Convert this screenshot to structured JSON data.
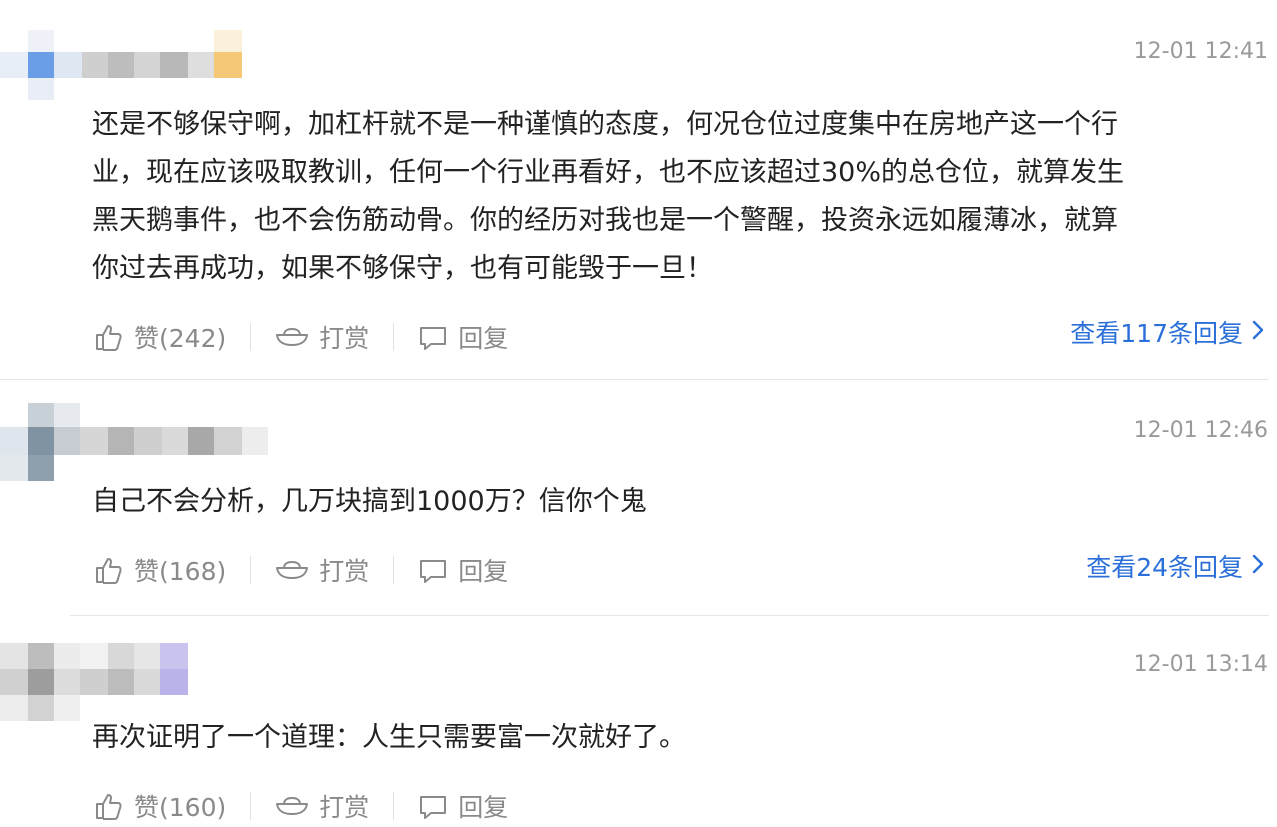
{
  "comments": [
    {
      "time": "12-01 12:41",
      "text": "还是不够保守啊，加杠杆就不是一种谨慎的态度，何况仓位过度集中在房地产这一个行\n业，现在应该吸取教训，任何一个行业再看好，也不应该超过30%的总仓位，就算发生\n黑天鹅事件，也不会伤筋动骨。你的经历对我也是一个警醒，投资永远如履薄冰，就算\n你过去再成功，如果不够保守，也有可能毁于一旦！",
      "like_label": "赞(242)",
      "reward_label": "打赏",
      "reply_label": "回复",
      "view_replies": "查看117条回复"
    },
    {
      "time": "12-01 12:46",
      "text": "自己不会分析，几万块搞到1000万？信你个鬼",
      "like_label": "赞(168)",
      "reward_label": "打赏",
      "reply_label": "回复",
      "view_replies": "查看24条回复"
    },
    {
      "time": "12-01 13:14",
      "text": "再次证明了一个道理：人生只需要富一次就好了。",
      "like_label": "赞(160)",
      "reward_label": "打赏",
      "reply_label": "回复"
    }
  ],
  "icons": {
    "like": "thumbs-up-icon",
    "reward": "ingot-icon",
    "reply": "chat-bubble-icon",
    "chevron": "chevron-right-icon"
  },
  "colors": {
    "link": "#2b6fd8",
    "meta": "#9a9a9a",
    "action": "#8a8a8a",
    "text": "#222222"
  }
}
